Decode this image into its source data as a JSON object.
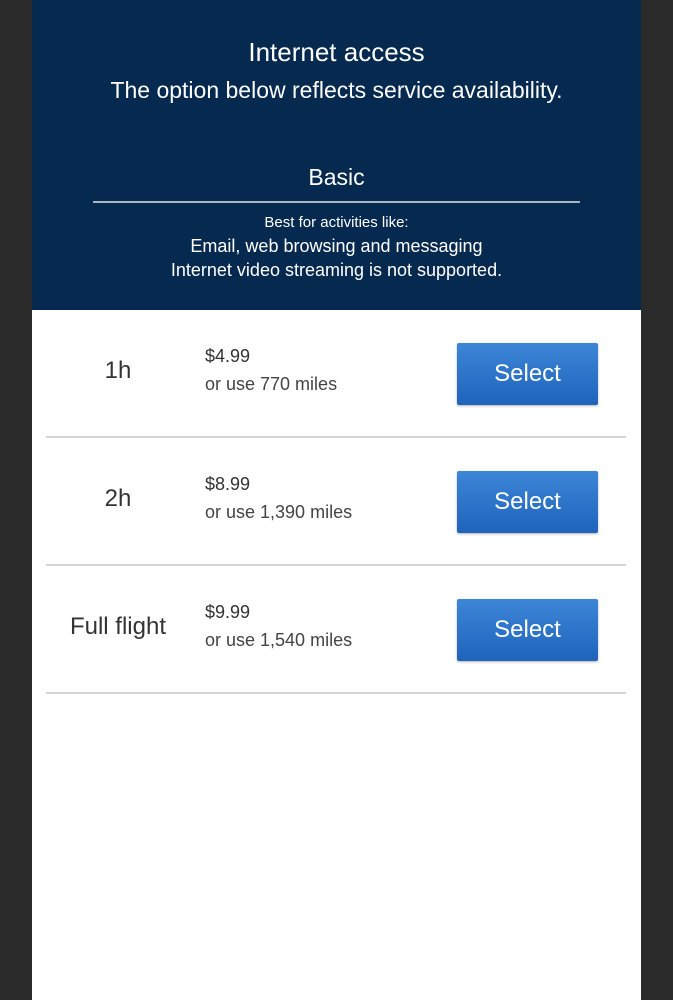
{
  "header": {
    "title": "Internet access",
    "subtitle": "The option below reflects service availability.",
    "tier_name": "Basic",
    "best_for_label": "Best for activities like:",
    "activities": "Email, web browsing and messaging",
    "note": "Internet video streaming is not supported."
  },
  "plans": [
    {
      "duration": "1h",
      "price": "$4.99",
      "miles": "or use 770 miles",
      "button_label": "Select"
    },
    {
      "duration": "2h",
      "price": "$8.99",
      "miles": "or use 1,390 miles",
      "button_label": "Select"
    },
    {
      "duration": "Full flight",
      "price": "$9.99",
      "miles": "or use 1,540 miles",
      "button_label": "Select"
    }
  ],
  "colors": {
    "header_bg": "#05294f",
    "button_bg": "#2a73c9",
    "divider": "#d6d6d6"
  }
}
